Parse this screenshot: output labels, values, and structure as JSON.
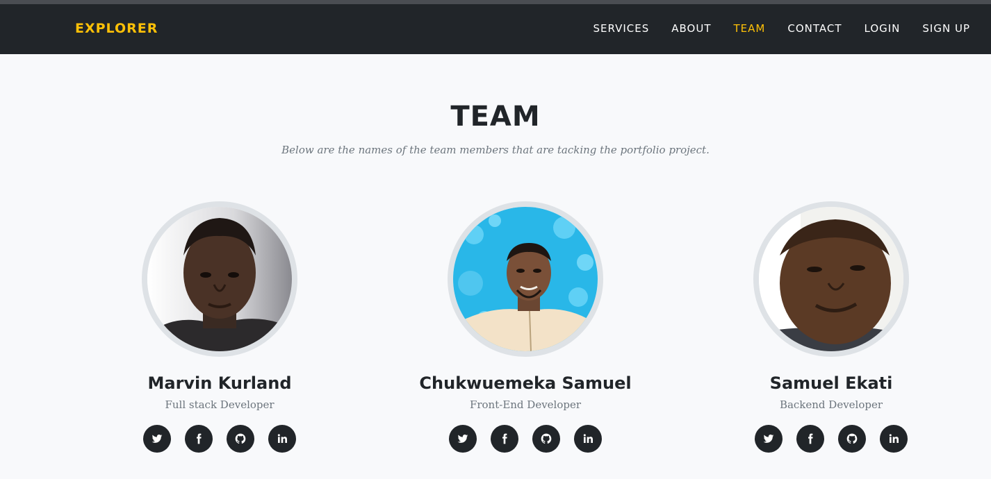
{
  "brand": "EXPLORER",
  "nav": [
    {
      "label": "SERVICES",
      "active": false
    },
    {
      "label": "ABOUT",
      "active": false
    },
    {
      "label": "TEAM",
      "active": true
    },
    {
      "label": "CONTACT",
      "active": false
    },
    {
      "label": "LOGIN",
      "active": false
    },
    {
      "label": "SIGN UP",
      "active": false
    }
  ],
  "section": {
    "title": "TEAM",
    "subtitle": "Below are the names of the team members that are tacking the portfolio project."
  },
  "members": [
    {
      "name": "Marvin Kurland",
      "role": "Full stack Developer"
    },
    {
      "name": "Chukwuemeka Samuel",
      "role": "Front-End Developer"
    },
    {
      "name": "Samuel Ekati",
      "role": "Backend Developer"
    }
  ],
  "social_icons": [
    "twitter-icon",
    "facebook-icon",
    "github-icon",
    "linkedin-icon"
  ],
  "colors": {
    "navbar_bg": "#212529",
    "accent": "#ffc107",
    "page_bg": "#f8f9fb",
    "muted_text": "#6c757d"
  }
}
